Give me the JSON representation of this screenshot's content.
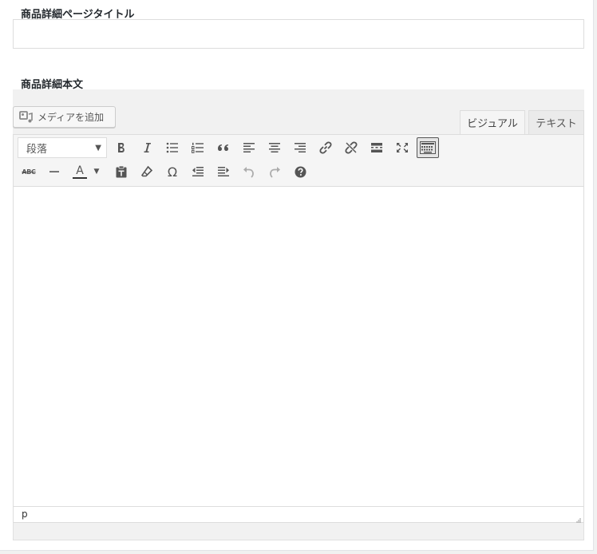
{
  "page_title_field": {
    "label": "商品詳細ページタイトル",
    "value": "",
    "placeholder": ""
  },
  "content_field": {
    "label": "商品詳細本文"
  },
  "media_button": {
    "label": "メディアを追加"
  },
  "tabs": [
    {
      "label": "ビジュアル",
      "active": true
    },
    {
      "label": "テキスト",
      "active": false
    }
  ],
  "toolbar": {
    "format_select": {
      "selected": "段落"
    },
    "row1": [
      "bold-icon",
      "italic-icon",
      "bullet-list-icon",
      "numbered-list-icon",
      "blockquote-icon",
      "align-left-icon",
      "align-center-icon",
      "align-right-icon",
      "link-icon",
      "unlink-icon",
      "read-more-icon",
      "fullscreen-icon",
      "toolbar-toggle-icon"
    ],
    "row2": [
      "strikethrough-icon",
      "horizontal-line-icon",
      "text-color-icon",
      "paste-as-text-icon",
      "clear-formatting-icon",
      "special-character-icon",
      "outdent-icon",
      "indent-icon",
      "undo-icon",
      "redo-icon",
      "help-icon"
    ],
    "strikethrough_glyph": "ABC",
    "text_color_glyph": "A",
    "omega_glyph": "Ω"
  },
  "status_bar": {
    "path": "p"
  },
  "colors": {
    "toolbar_bg": "#f5f5f5",
    "border": "#dddddd",
    "page_bg": "#f1f1f1"
  }
}
